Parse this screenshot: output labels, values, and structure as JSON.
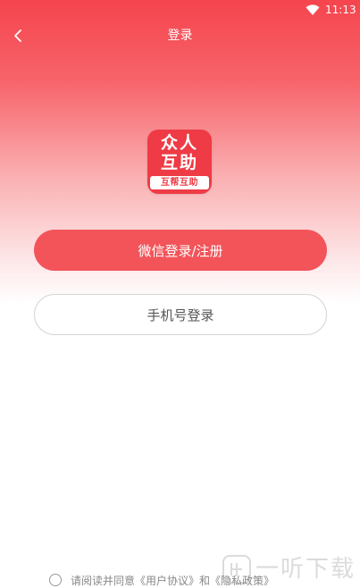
{
  "status_bar": {
    "time": "11:13",
    "wifi_icon": "wifi-icon"
  },
  "header": {
    "title": "登录",
    "back_icon": "chevron-left-icon"
  },
  "logo": {
    "line1": "众人",
    "line2": "互助",
    "ribbon": "互帮互助"
  },
  "buttons": {
    "wechat_label": "微信登录/注册",
    "phone_label": "手机号登录"
  },
  "agreement": {
    "prefix": "请阅读并同意",
    "user_agreement": "《用户协议》",
    "and": "和",
    "privacy_policy": "《隐私政策》",
    "checked": false
  },
  "watermark": {
    "text": "一听下载"
  },
  "colors": {
    "brand_red": "#f2545a",
    "logo_red": "#ee3b45",
    "header_gradient_top": "#f5454e"
  }
}
